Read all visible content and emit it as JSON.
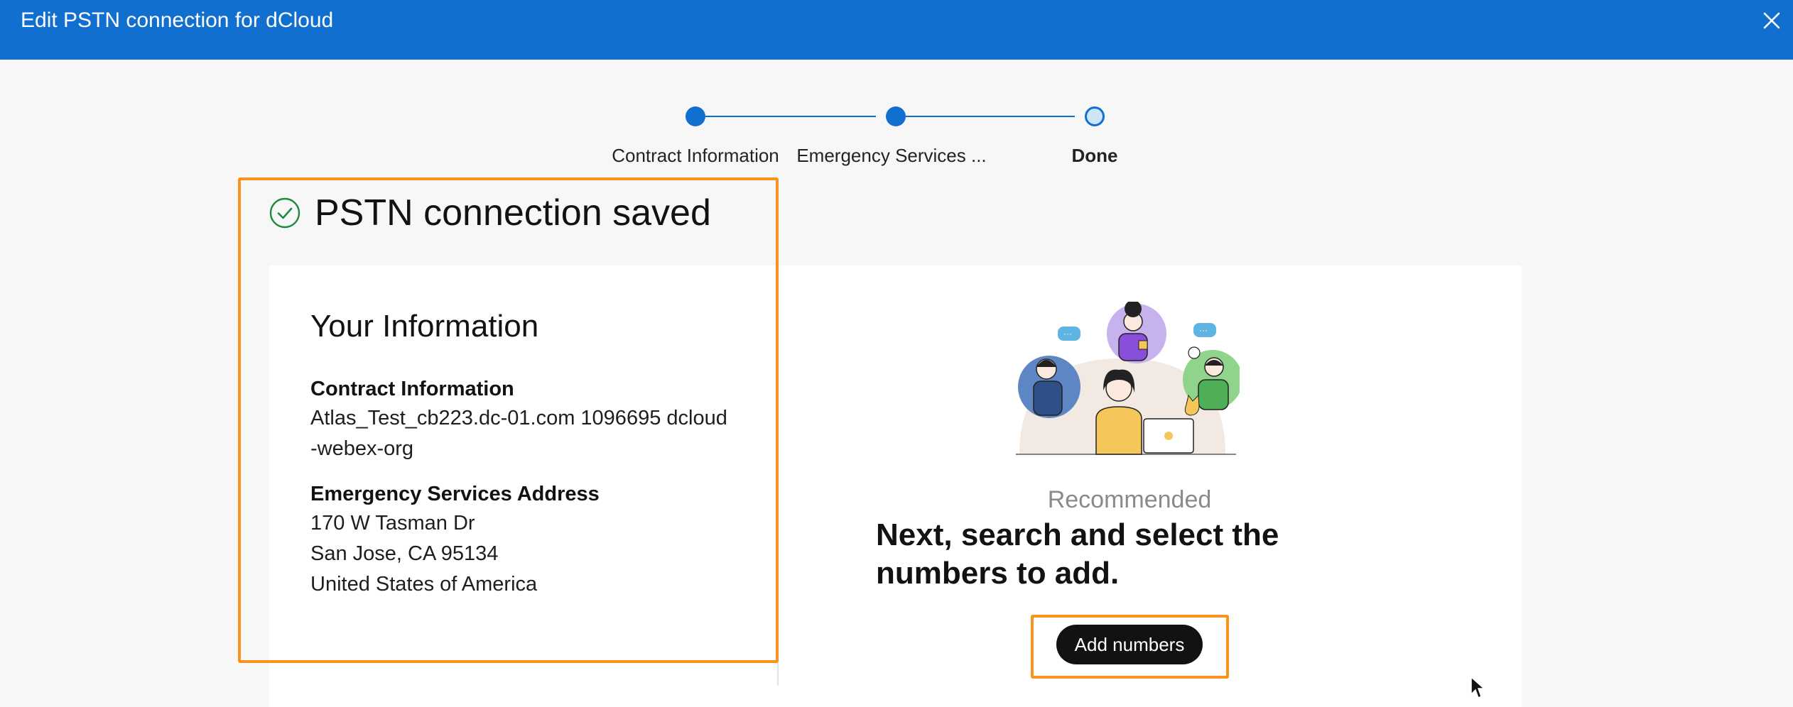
{
  "dialog": {
    "title": "Edit PSTN connection for dCloud",
    "close_icon": "close-icon"
  },
  "stepper": {
    "steps": [
      {
        "label": "Contract Information",
        "state": "complete"
      },
      {
        "label": "Emergency Services ...",
        "state": "complete"
      },
      {
        "label": "Done",
        "state": "current"
      }
    ]
  },
  "status": {
    "icon": "check-circle-icon",
    "heading": "PSTN connection saved"
  },
  "your_information": {
    "title": "Your Information",
    "contract": {
      "label": "Contract Information",
      "lines": [
        "Atlas_Test_cb223.dc-01.com 1096695 dcloud",
        "-webex-org"
      ]
    },
    "emergency": {
      "label": "Emergency Services Address",
      "lines": [
        "170 W Tasman Dr",
        "San Jose, CA 95134",
        "United States of America"
      ]
    }
  },
  "next_step": {
    "recommended": "Recommended",
    "text": "Next, search and select the numbers to add.",
    "button_label": "Add numbers"
  },
  "colors": {
    "header_bg": "#1170cf",
    "highlight": "#f7931e",
    "success": "#1d8a3f",
    "button_bg": "#121212"
  }
}
